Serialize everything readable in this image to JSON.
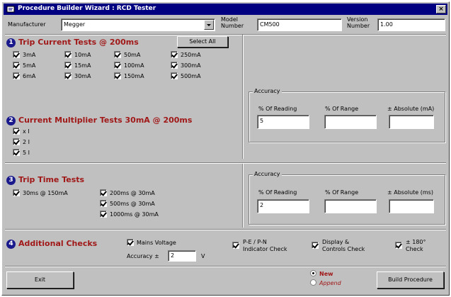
{
  "window": {
    "title": "Procedure Builder Wizard : RCD Tester",
    "close_label": "×"
  },
  "header": {
    "manufacturer_label": "Manufacturer",
    "manufacturer_value": "Megger",
    "model_label_1": "Model",
    "model_label_2": "Number",
    "model_value": "CM500",
    "version_label_1": "Version",
    "version_label_2": "Number",
    "version_value": "1.00"
  },
  "section1": {
    "number": "1",
    "title": "Trip Current Tests @ 200ms",
    "select_all_label": "Select All",
    "checks": [
      "3mA",
      "5mA",
      "6mA",
      "10mA",
      "15mA",
      "30mA",
      "50mA",
      "100mA",
      "150mA",
      "250mA",
      "300mA",
      "500mA"
    ]
  },
  "section2": {
    "number": "2",
    "title": "Current Multiplier Tests 30mA @ 200ms",
    "checks": [
      "x I",
      "2 I",
      "5 I"
    ]
  },
  "accuracy1": {
    "group_label": "Accuracy",
    "reading_label": "% Of Reading",
    "range_label": "% Of Range",
    "absolute_label": "± Absolute (mA)",
    "reading_value": "5",
    "range_value": "",
    "absolute_value": ""
  },
  "section3": {
    "number": "3",
    "title": "Trip Time Tests",
    "checks": [
      "30ms @ 150mA",
      "200ms @ 30mA",
      "500ms @ 30mA",
      "1000ms @ 30mA"
    ]
  },
  "accuracy2": {
    "group_label": "Accuracy",
    "reading_label": "% Of Reading",
    "range_label": "% Of Range",
    "absolute_label": "± Absolute (ms)",
    "reading_value": "2",
    "range_value": "",
    "absolute_value": ""
  },
  "section4": {
    "number": "4",
    "title": "Additional Checks",
    "mains_voltage_label": "Mains Voltage",
    "accuracy_label": "Accuracy ±",
    "accuracy_value": "2",
    "accuracy_unit": "V",
    "pe_label_1": "P-E / P-N",
    "pe_label_2": "Indicator Check",
    "display_label_1": "Display &",
    "display_label_2": "Controls Check",
    "angle_label_1": "± 180°",
    "angle_label_2": "Check"
  },
  "footer": {
    "exit_label": "Exit",
    "new_label": "New",
    "append_label": "Append",
    "build_label": "Build Procedure"
  },
  "colors": {
    "title_bar": "#000080",
    "section_title": "#a01818",
    "badge": "#1a1a8c",
    "face": "#c0c0c0"
  }
}
